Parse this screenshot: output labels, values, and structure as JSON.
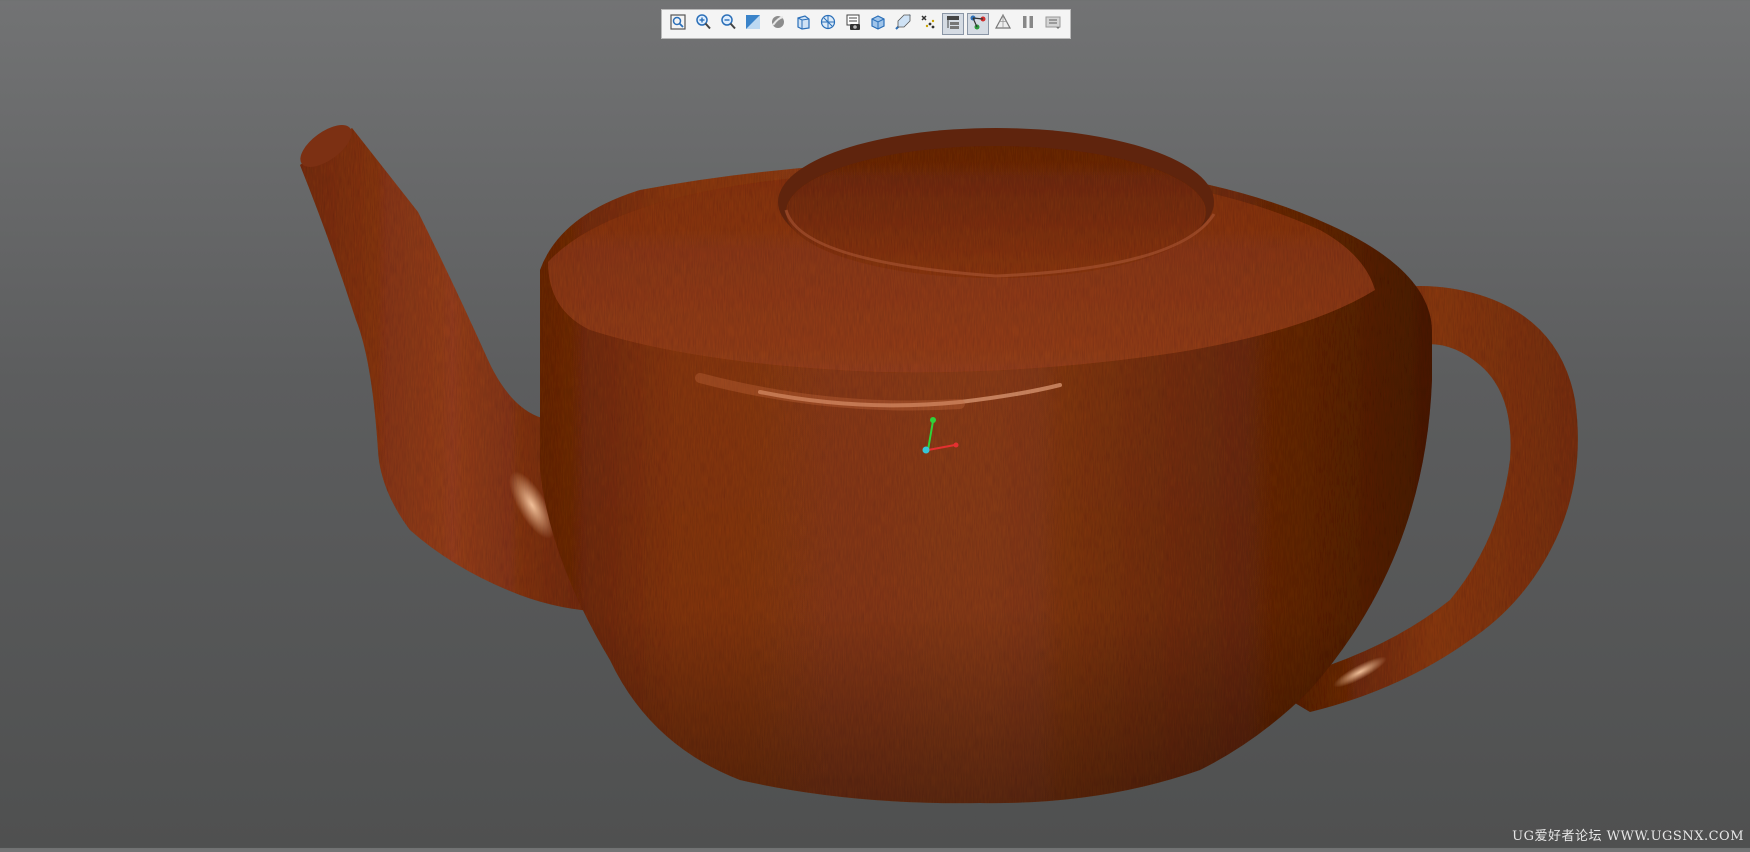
{
  "viewport": {
    "background_top": "#727374",
    "background_bottom": "#4f5050",
    "model_color": "#8a3614"
  },
  "toolbar": {
    "buttons": [
      {
        "icon": "fit-view-icon",
        "active": false
      },
      {
        "icon": "zoom-in-icon",
        "active": false
      },
      {
        "icon": "zoom-out-icon",
        "active": false
      },
      {
        "icon": "shading-icon",
        "active": false
      },
      {
        "icon": "rendering-style-icon",
        "active": false
      },
      {
        "icon": "orient-view-icon",
        "active": false
      },
      {
        "icon": "perspective-icon",
        "active": false
      },
      {
        "icon": "snapshot-icon",
        "active": false
      },
      {
        "icon": "view-cube-icon",
        "active": false
      },
      {
        "icon": "section-icon",
        "active": false
      },
      {
        "icon": "snap-point-icon",
        "active": false
      },
      {
        "icon": "selection-filter-icon",
        "active": true
      },
      {
        "icon": "show-connections-icon",
        "active": true
      },
      {
        "icon": "triangle-mesh-icon",
        "active": false
      },
      {
        "icon": "pause-icon",
        "active": false
      },
      {
        "icon": "menu-icon",
        "active": false
      }
    ]
  },
  "watermark": {
    "text": "UG爱好者论坛 WWW.UGSNX.COM"
  }
}
